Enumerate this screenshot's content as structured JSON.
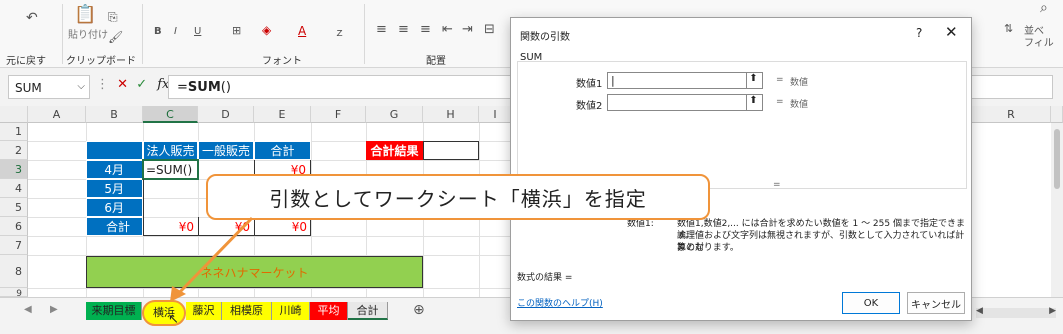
{
  "ribbon": {
    "undo_label": "元に戻す",
    "paste_label": "貼り付け",
    "clipboard_label": "クリップボード",
    "font_label": "フォント",
    "align_label": "配置",
    "font_buttons": [
      "B",
      "I",
      "U",
      "A"
    ],
    "sort_hint": "並べ",
    "sort_hint2": "フィル"
  },
  "formula_bar": {
    "name_box": "SUM",
    "formula_prefix": "=",
    "formula_fn": "SUM",
    "formula_suffix": "()"
  },
  "columns": [
    "A",
    "B",
    "C",
    "D",
    "E",
    "F",
    "G",
    "H",
    "I",
    "R"
  ],
  "rows": [
    "1",
    "2",
    "3",
    "4",
    "5",
    "6",
    "7",
    "8",
    "9"
  ],
  "table": {
    "headers": [
      "法人販売",
      "一般販売",
      "合計"
    ],
    "months": [
      "4月",
      "5月",
      "6月",
      "合計"
    ],
    "c3_text": "=SUM()",
    "e3_value": "¥0",
    "c6_value": "¥0",
    "d6_value": "¥0",
    "e6_value": "¥0",
    "result_label": "合計結果",
    "banner": "ネネハナマーケット"
  },
  "callout_text": "引数としてワークシート「横浜」を指定",
  "sheet_tabs": [
    {
      "label": "来期目標",
      "color": "#00b050"
    },
    {
      "label": "横浜",
      "color": "#ffff00"
    },
    {
      "label": "藤沢",
      "color": "#ffff00"
    },
    {
      "label": "相模原",
      "color": "#ffff00"
    },
    {
      "label": "川崎",
      "color": "#ffff00"
    },
    {
      "label": "平均",
      "color": "#ff0000"
    },
    {
      "label": "合計",
      "color": "#d9d9d9"
    }
  ],
  "add_sheet": "⊕",
  "dialog": {
    "title": "関数の引数",
    "help_q": "?",
    "close": "✕",
    "function_name": "SUM",
    "arg1_label": "数値1",
    "arg2_label": "数値2",
    "arg_eq": "=",
    "arg1_hint": "数値",
    "arg2_hint": "数値",
    "result_eq": "=",
    "desc_prefix": "数値1,数値2,... には合計を求めたい数値を 1 ～ 255 個まで指定できます。",
    "desc_line2": "論理値および文字列は無視されますが、引数として入力されていれば計算の対",
    "desc_line3": "象となります。",
    "desc_left": "数値1:",
    "formula_result_label": "数式の結果 =",
    "help_link": "この関数のヘルプ(H)",
    "ok": "OK",
    "cancel": "キャンセル"
  },
  "colors": {
    "accent_blue": "#0070c0",
    "banner_green": "#92d050",
    "result_red": "#ff0000",
    "callout_orange": "#f0943a",
    "excel_green": "#217346"
  }
}
